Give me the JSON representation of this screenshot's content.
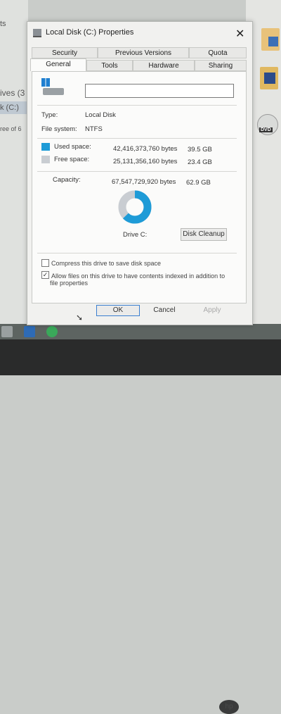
{
  "background": {
    "left_texts": [
      "ts",
      "ives (3",
      "k (C:)",
      "ree of 6"
    ],
    "dvd_label": "DVD"
  },
  "dialog": {
    "title": "Local Disk (C:) Properties",
    "close_glyph": "✕",
    "tabs_top": [
      "Security",
      "Previous Versions",
      "Quota"
    ],
    "tabs_bottom": [
      "General",
      "Tools",
      "Hardware",
      "Sharing"
    ],
    "active_tab": "General",
    "name_value": "",
    "type_label": "Type:",
    "type_value": "Local Disk",
    "fs_label": "File system:",
    "fs_value": "NTFS",
    "used_label": "Used space:",
    "used_bytes": "42,416,373,760 bytes",
    "used_gb": "39.5 GB",
    "free_label": "Free space:",
    "free_bytes": "25,131,356,160 bytes",
    "free_gb": "23.4 GB",
    "capacity_label": "Capacity:",
    "capacity_bytes": "67,547,729,920 bytes",
    "capacity_gb": "62.9 GB",
    "used_fraction": 0.628,
    "used_color": "#1e9bd7",
    "free_color": "#c9cdd2",
    "drive_caption": "Drive C:",
    "cleanup_button": "Disk Cleanup",
    "compress_label": "Compress this drive to save disk space",
    "compress_checked": false,
    "index_label_1": "Allow files on this drive to have contents indexed in addition to",
    "index_label_2": "file properties",
    "index_checked": true,
    "ok_button": "OK",
    "cancel_button": "Cancel",
    "apply_button": "Apply"
  }
}
